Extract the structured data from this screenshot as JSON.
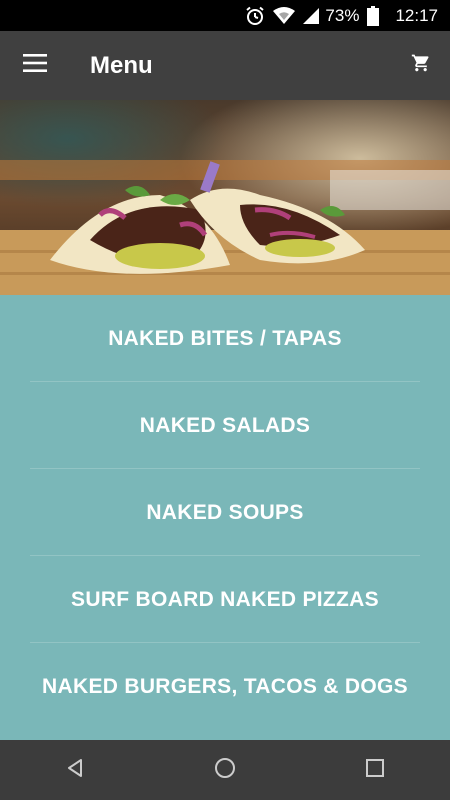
{
  "status_bar": {
    "battery_percent": "73%",
    "time": "12:17",
    "icons": [
      "alarm-icon",
      "wifi-icon",
      "cell-signal-icon",
      "battery-icon"
    ]
  },
  "app_bar": {
    "title": "Menu",
    "left_icon": "hamburger-menu-icon",
    "right_icon": "shopping-cart-icon"
  },
  "hero": {
    "image": "tacos-photo"
  },
  "menu": {
    "items": [
      {
        "label": "NAKED BITES / TAPAS"
      },
      {
        "label": "NAKED SALADS"
      },
      {
        "label": "NAKED SOUPS"
      },
      {
        "label": "SURF BOARD NAKED PIZZAS"
      },
      {
        "label": "NAKED BURGERS, TACOS & DOGS"
      }
    ]
  },
  "nav_bar": {
    "icons": [
      "back-icon",
      "home-icon",
      "recents-icon"
    ]
  },
  "colors": {
    "app_bar": "#404040",
    "list_background": "#7ab7b8",
    "text": "#ffffff",
    "nav_bar": "#3c3c3c"
  }
}
